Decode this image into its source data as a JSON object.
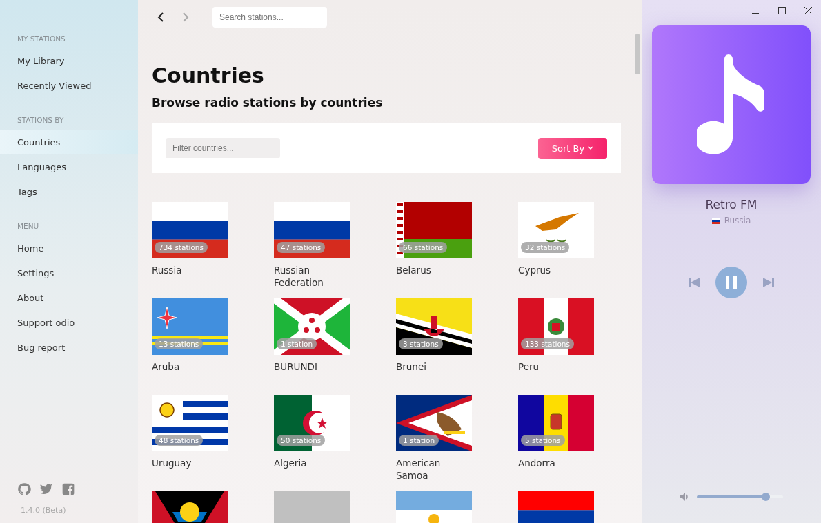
{
  "sidebar": {
    "sections": [
      {
        "heading": "MY STATIONS",
        "items": [
          {
            "label": "My Library",
            "selected": false
          },
          {
            "label": "Recently Viewed",
            "selected": false
          }
        ]
      },
      {
        "heading": "STATIONS BY",
        "items": [
          {
            "label": "Countries",
            "selected": true
          },
          {
            "label": "Languages",
            "selected": false
          },
          {
            "label": "Tags",
            "selected": false
          }
        ]
      },
      {
        "heading": "MENU",
        "items": [
          {
            "label": "Home",
            "selected": false
          },
          {
            "label": "Settings",
            "selected": false
          },
          {
            "label": "About",
            "selected": false
          },
          {
            "label": "Support odio",
            "selected": false
          },
          {
            "label": "Bug report",
            "selected": false
          }
        ]
      }
    ],
    "version": "1.4.0 (Beta)"
  },
  "search": {
    "placeholder": "Search stations..."
  },
  "page": {
    "title": "Countries",
    "subtitle": "Browse radio stations by countries"
  },
  "filter": {
    "placeholder": "Filter countries..."
  },
  "sort_button": "Sort By",
  "countries": [
    {
      "name": "Russia",
      "count": "734 stations"
    },
    {
      "name": "Russian Federation",
      "count": "47 stations"
    },
    {
      "name": "Belarus",
      "count": "66 stations"
    },
    {
      "name": "Cyprus",
      "count": "32 stations"
    },
    {
      "name": "Aruba",
      "count": "13 stations"
    },
    {
      "name": "BURUNDI",
      "count": "1 station"
    },
    {
      "name": "Brunei",
      "count": "3 stations"
    },
    {
      "name": "Peru",
      "count": "133 stations"
    },
    {
      "name": "Uruguay",
      "count": "48 stations"
    },
    {
      "name": "Algeria",
      "count": "50 stations"
    },
    {
      "name": "American Samoa",
      "count": "1 station"
    },
    {
      "name": "Andorra",
      "count": "5 stations"
    }
  ],
  "player": {
    "station": "Retro FM",
    "country": "Russia",
    "playing": true,
    "volume": {
      "level": 0.8
    }
  }
}
